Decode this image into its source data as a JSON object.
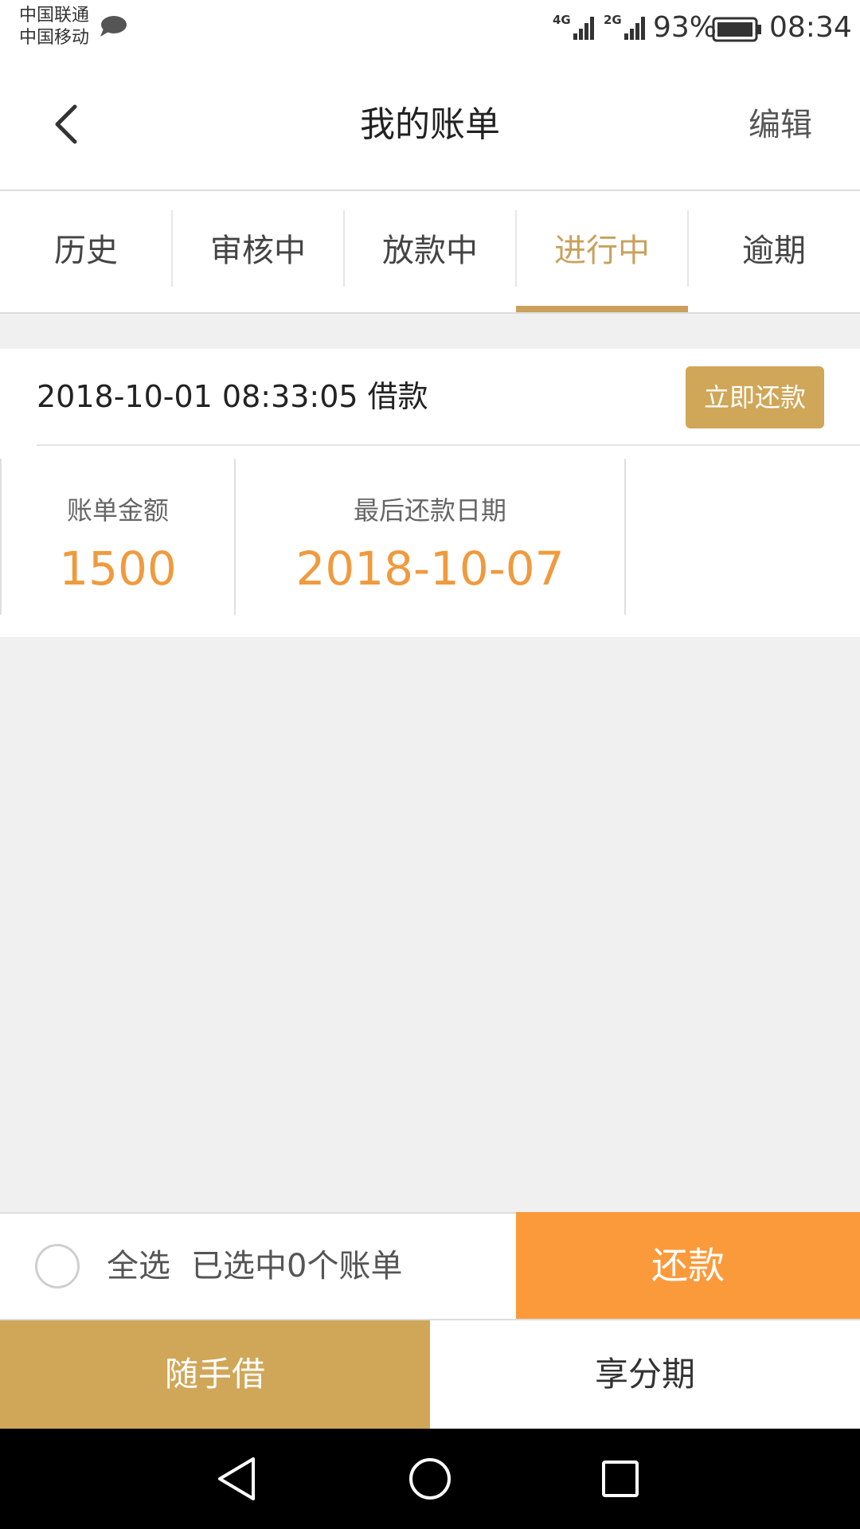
{
  "status_bar": {
    "carrier_1": "中国联通",
    "carrier_2": "中国移动",
    "net_1": "4G",
    "net_2": "2G",
    "battery": "93%",
    "time": "08:34"
  },
  "header": {
    "title": "我的账单",
    "edit_label": "编辑"
  },
  "tabs": [
    {
      "label": "历史",
      "active": false
    },
    {
      "label": "审核中",
      "active": false
    },
    {
      "label": "放款中",
      "active": false
    },
    {
      "label": "进行中",
      "active": true
    },
    {
      "label": "逾期",
      "active": false
    }
  ],
  "bill": {
    "title": "2018-10-01 08:33:05 借款",
    "repay_now_label": "立即还款",
    "amount_label": "账单金额",
    "amount_value": "1500",
    "due_label": "最后还款日期",
    "due_value": "2018-10-07"
  },
  "action_bar": {
    "select_all_label": "全选",
    "selected_count_text": "已选中0个账单",
    "repay_label": "还款"
  },
  "bottom_nav": {
    "item_1": "随手借",
    "item_2": "享分期"
  },
  "colors": {
    "accent_gold": "#c9a15d",
    "button_gold": "#d0a658",
    "value_orange": "#f09a3e",
    "repay_orange": "#fb9a3b",
    "background": "#f0f0f0"
  }
}
